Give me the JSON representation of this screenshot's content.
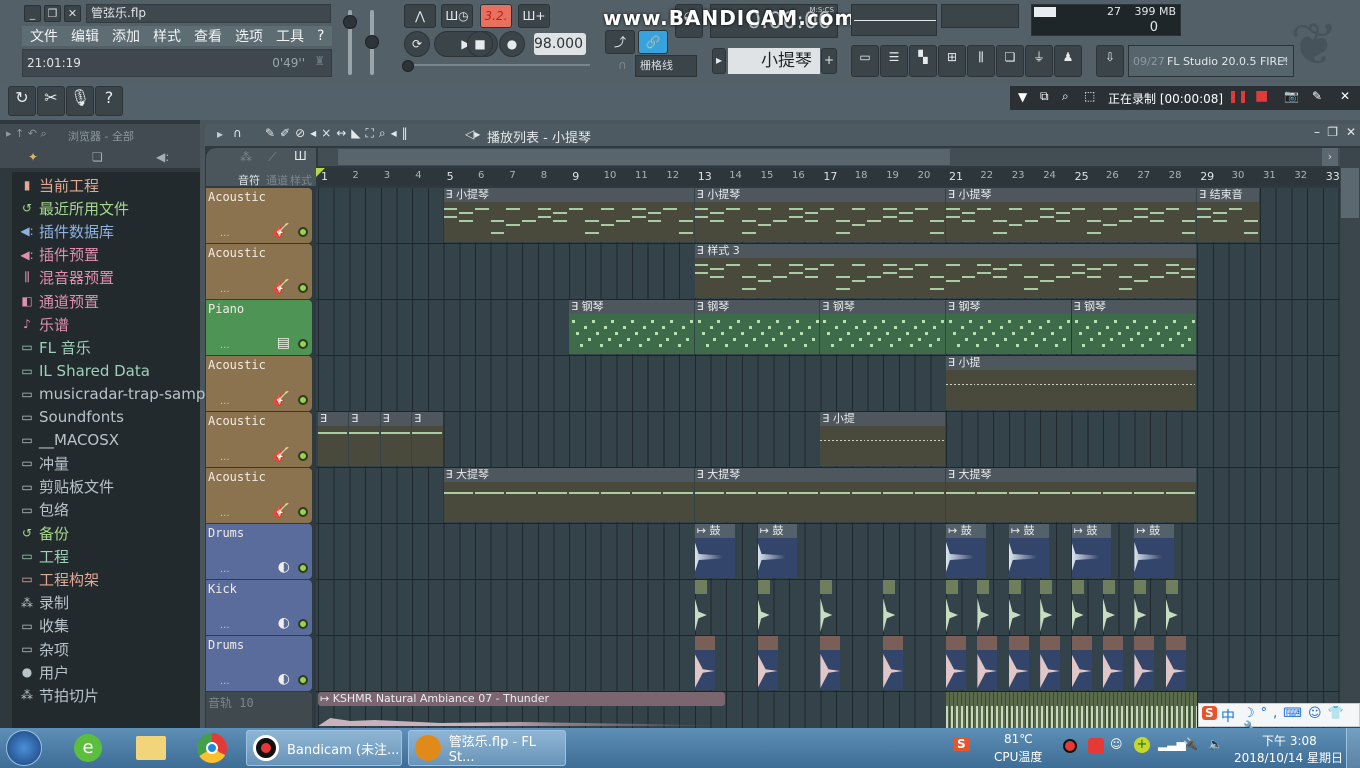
{
  "window": {
    "title": "管弦乐.flp",
    "menu": [
      "文件",
      "编辑",
      "添加",
      "样式",
      "查看",
      "选项",
      "工具",
      "?"
    ],
    "hint_time": "21:01:19",
    "hint_duration": "0'49''"
  },
  "transport": {
    "pattern_song_indicator": "3.2.",
    "tempo": "98.000",
    "time_display": "0:00:00",
    "time_format": "M:S:CS",
    "snap": "栅格线",
    "selected_pattern": "小提琴",
    "watermark": "www.BANDICAM.com"
  },
  "monitor": {
    "cpu": "27",
    "memory": "399 MB",
    "polyphony": "0"
  },
  "news": {
    "index": "09/27",
    "text": "FL Studio 20.0.5 FIRE!"
  },
  "recorder": {
    "status": "正在录制 [00:00:08]"
  },
  "browser": {
    "title": "浏览器 - 全部",
    "items": [
      {
        "label": "当前工程",
        "icon": "file-icon",
        "color": "#e2a894"
      },
      {
        "label": "最近所用文件",
        "icon": "recent-folder-icon",
        "color": "#a5d88b"
      },
      {
        "label": "插件数据库",
        "icon": "plugin-icon",
        "color": "#8fb1e0"
      },
      {
        "label": "插件预置",
        "icon": "plugin-preset-icon",
        "color": "#e08fb0"
      },
      {
        "label": "混音器预置",
        "icon": "mixer-icon",
        "color": "#e08fb0"
      },
      {
        "label": "通道预置",
        "icon": "channel-icon",
        "color": "#e08fb0"
      },
      {
        "label": "乐谱",
        "icon": "note-icon",
        "color": "#e08fb0"
      },
      {
        "label": "FL 音乐",
        "icon": "folder-plus-icon",
        "color": "#9fd0b8"
      },
      {
        "label": "IL Shared Data",
        "icon": "folder-plus-icon",
        "color": "#9fd0b8"
      },
      {
        "label": "musicradar-trap-samples",
        "icon": "folder-icon",
        "color": "#b8c4ca"
      },
      {
        "label": "Soundfonts",
        "icon": "folder-icon",
        "color": "#b8c4ca"
      },
      {
        "label": "__MACOSX",
        "icon": "folder-icon",
        "color": "#b8c4ca"
      },
      {
        "label": "冲量",
        "icon": "folder-icon",
        "color": "#b8c4ca"
      },
      {
        "label": "剪贴板文件",
        "icon": "folder-icon",
        "color": "#b8c4ca"
      },
      {
        "label": "包络",
        "icon": "folder-icon",
        "color": "#b8c4ca"
      },
      {
        "label": "备份",
        "icon": "recent-folder-icon",
        "color": "#a5d88b"
      },
      {
        "label": "工程",
        "icon": "folder-plus-icon",
        "color": "#9fd0b8"
      },
      {
        "label": "工程构架",
        "icon": "folder-icon",
        "color": "#e2a894"
      },
      {
        "label": "录制",
        "icon": "wave-icon",
        "color": "#b8c4ca"
      },
      {
        "label": "收集",
        "icon": "folder-icon",
        "color": "#b8c4ca"
      },
      {
        "label": "杂项",
        "icon": "folder-icon",
        "color": "#b8c4ca"
      },
      {
        "label": "用户",
        "icon": "user-icon",
        "color": "#b8c4ca"
      },
      {
        "label": "节拍切片",
        "icon": "wave-icon",
        "color": "#b8c4ca"
      }
    ]
  },
  "playlist": {
    "title": "播放列表 - 小提琴",
    "tabs": [
      "音符",
      "通道",
      "样式"
    ],
    "bars": [
      1,
      2,
      3,
      4,
      5,
      6,
      7,
      8,
      9,
      10,
      11,
      12,
      13,
      14,
      15,
      16,
      17,
      18,
      19,
      20,
      21,
      22,
      23,
      24,
      25,
      26,
      27,
      28,
      29,
      30,
      31,
      32,
      33
    ],
    "tracks": [
      {
        "name": "Acoustic",
        "color": "#8c7350",
        "icon": "guitar-icon"
      },
      {
        "name": "Acoustic",
        "color": "#8c7350",
        "icon": "guitar-icon"
      },
      {
        "name": "Piano",
        "color": "#4e9454",
        "icon": "piano-icon"
      },
      {
        "name": "Acoustic",
        "color": "#8c7350",
        "icon": "guitar-icon"
      },
      {
        "name": "Acoustic",
        "color": "#8c7350",
        "icon": "guitar-icon"
      },
      {
        "name": "Acoustic",
        "color": "#8c7350",
        "icon": "guitar-icon"
      },
      {
        "name": "Drums",
        "color": "#5a6c9c",
        "icon": "drum-icon"
      },
      {
        "name": "Kick",
        "color": "#5a6c9c",
        "icon": "drum-icon"
      },
      {
        "name": "Drums",
        "color": "#5a6c9c",
        "icon": "drum-icon"
      },
      {
        "name": "音轨 10",
        "color": "#3f494e",
        "icon": ""
      }
    ],
    "clips": [
      {
        "track": 0,
        "start": 5,
        "len": 8,
        "label": "小提琴",
        "type": "pattern"
      },
      {
        "track": 0,
        "start": 13,
        "len": 8,
        "label": "小提琴",
        "type": "pattern"
      },
      {
        "track": 0,
        "start": 21,
        "len": 8,
        "label": "小提琴",
        "type": "pattern"
      },
      {
        "track": 0,
        "start": 29,
        "len": 2,
        "label": "结束音",
        "type": "pattern"
      },
      {
        "track": 1,
        "start": 13,
        "len": 16,
        "label": "样式 3",
        "type": "pattern"
      },
      {
        "track": 2,
        "start": 9,
        "len": 4,
        "label": "钢琴",
        "type": "piano"
      },
      {
        "track": 2,
        "start": 13,
        "len": 4,
        "label": "钢琴",
        "type": "piano"
      },
      {
        "track": 2,
        "start": 17,
        "len": 4,
        "label": "钢琴",
        "type": "piano"
      },
      {
        "track": 2,
        "start": 21,
        "len": 4,
        "label": "钢琴",
        "type": "piano"
      },
      {
        "track": 2,
        "start": 25,
        "len": 4,
        "label": "钢琴",
        "type": "piano"
      },
      {
        "track": 3,
        "start": 21,
        "len": 8,
        "label": "小提",
        "type": "sparse"
      },
      {
        "track": 4,
        "start": 1,
        "len": 1,
        "label": "",
        "type": "single"
      },
      {
        "track": 4,
        "start": 2,
        "len": 1,
        "label": "",
        "type": "single"
      },
      {
        "track": 4,
        "start": 3,
        "len": 1,
        "label": "",
        "type": "single"
      },
      {
        "track": 4,
        "start": 4,
        "len": 1,
        "label": "",
        "type": "single"
      },
      {
        "track": 4,
        "start": 17,
        "len": 4,
        "label": "小提",
        "type": "sparse"
      },
      {
        "track": 5,
        "start": 5,
        "len": 8,
        "label": "大提琴",
        "type": "bass"
      },
      {
        "track": 5,
        "start": 13,
        "len": 8,
        "label": "大提琴",
        "type": "bass"
      },
      {
        "track": 5,
        "start": 21,
        "len": 8,
        "label": "大提琴",
        "type": "bass"
      },
      {
        "track": 6,
        "start": 13,
        "len": 1.3,
        "label": "鼓",
        "type": "drum"
      },
      {
        "track": 6,
        "start": 15,
        "len": 1.3,
        "label": "鼓",
        "type": "drum"
      },
      {
        "track": 6,
        "start": 21,
        "len": 1.3,
        "label": "鼓",
        "type": "drum"
      },
      {
        "track": 6,
        "start": 23,
        "len": 1.3,
        "label": "鼓",
        "type": "drum"
      },
      {
        "track": 6,
        "start": 25,
        "len": 1.3,
        "label": "鼓",
        "type": "drum"
      },
      {
        "track": 6,
        "start": 27,
        "len": 1.3,
        "label": "鼓",
        "type": "drum"
      },
      {
        "track": 9,
        "start": 1,
        "len": 13,
        "label": "KSHMR Natural Ambiance 07 - Thunder",
        "type": "audio"
      }
    ],
    "kick_bars": [
      13,
      15,
      17,
      19,
      21,
      22,
      23,
      24,
      25,
      26,
      27,
      28
    ],
    "snare_bars": [
      13,
      15,
      17,
      19,
      21,
      22,
      23,
      24,
      25,
      26,
      27,
      28
    ]
  },
  "taskbar": {
    "apps": [
      "Bandicam (未注...",
      "管弦乐.flp - FL St..."
    ],
    "cpu_temp": "81℃",
    "cpu_label": "CPU温度",
    "time": "下午 3:08",
    "date": "2018/10/14 星期日",
    "ime": "中"
  }
}
